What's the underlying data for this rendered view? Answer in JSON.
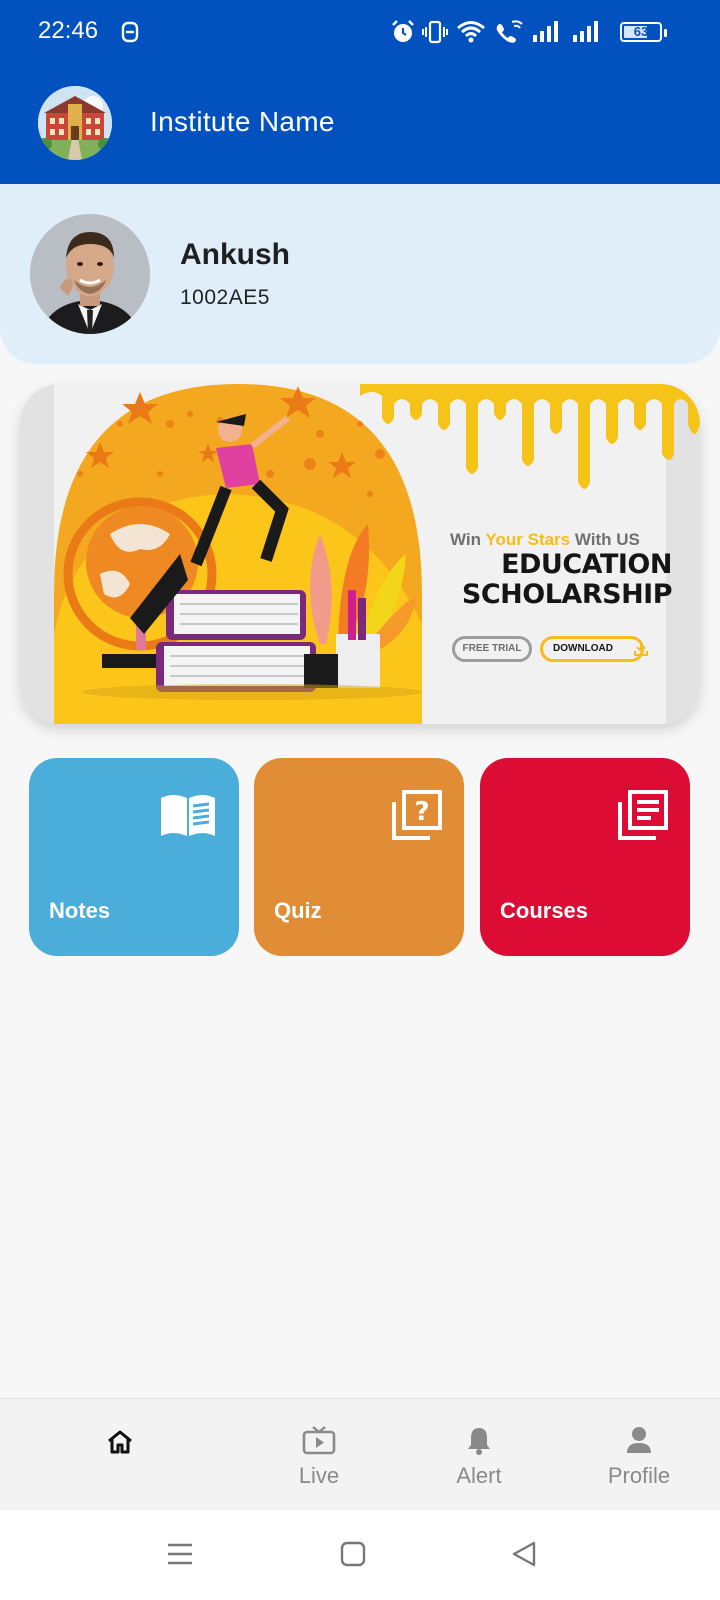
{
  "status_bar": {
    "time": "22:46",
    "battery_percent": "63",
    "icons": [
      "data-saver-icon",
      "alarm-icon",
      "vibrate-icon",
      "wifi-icon",
      "wifi-calling-icon",
      "signal-1-icon",
      "signal-2-icon",
      "battery-icon"
    ]
  },
  "app_bar": {
    "institute_name": "Institute Name",
    "logo_icon": "institute-building-logo"
  },
  "profile": {
    "name": "Ankush",
    "id": "1002AE5",
    "avatar_icon": "user-avatar"
  },
  "banner": {
    "tagline_part1": "Win ",
    "tagline_highlight": "Your Stars",
    "tagline_part2": " With US",
    "title_line1": "EDUCATION",
    "title_line2": "SCHOLARSHIP",
    "button_trial": "FREE TRIAL",
    "button_download": "DOWNLOAD",
    "colors": {
      "yellow": "#f6bd1a",
      "orange": "#f19a1c"
    }
  },
  "tiles": [
    {
      "label": "Notes",
      "icon": "open-book-icon",
      "color": "#4badd9"
    },
    {
      "label": "Quiz",
      "icon": "quiz-question-icon",
      "color": "#e08d36"
    },
    {
      "label": "Courses",
      "icon": "courses-list-icon",
      "color": "#dc0c34"
    }
  ],
  "bottom_nav": {
    "items": [
      {
        "label": "",
        "icon": "home-icon",
        "active": true
      },
      {
        "label": "Live",
        "icon": "live-tv-icon",
        "active": false
      },
      {
        "label": "Alert",
        "icon": "bell-icon",
        "active": false
      },
      {
        "label": "Profile",
        "icon": "person-icon",
        "active": false
      }
    ]
  },
  "system_nav": {
    "icons": [
      "menu-icon",
      "home-square-icon",
      "back-triangle-icon"
    ]
  },
  "theme": {
    "primary": "#0152bf",
    "profile_bg": "#dfeef8",
    "page_bg": "#f7f7f7"
  }
}
